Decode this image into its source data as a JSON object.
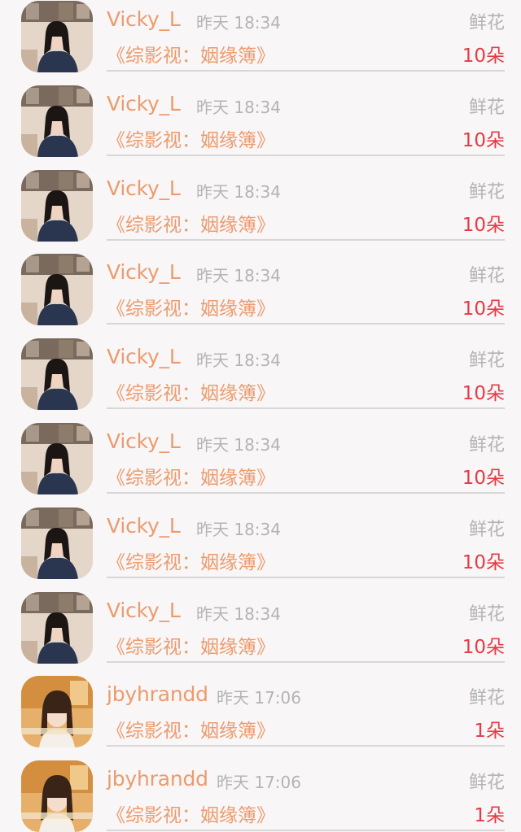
{
  "colors": {
    "username": "#ec9b6e",
    "show_title": "#ec9b6e",
    "count": "#e63a45",
    "muted": "#b4b4b4",
    "divider": "#d8d6d6",
    "background": "#f8f6f6"
  },
  "gifts": [
    {
      "avatar": "avatar-woman-indoor",
      "user": "Vicky_L",
      "time": "昨天 18:34",
      "gift_type": "鲜花",
      "show": "《综影视：姻缘簿》",
      "count": "10朵"
    },
    {
      "avatar": "avatar-woman-indoor",
      "user": "Vicky_L",
      "time": "昨天 18:34",
      "gift_type": "鲜花",
      "show": "《综影视：姻缘簿》",
      "count": "10朵"
    },
    {
      "avatar": "avatar-woman-indoor",
      "user": "Vicky_L",
      "time": "昨天 18:34",
      "gift_type": "鲜花",
      "show": "《综影视：姻缘簿》",
      "count": "10朵"
    },
    {
      "avatar": "avatar-woman-indoor",
      "user": "Vicky_L",
      "time": "昨天 18:34",
      "gift_type": "鲜花",
      "show": "《综影视：姻缘簿》",
      "count": "10朵"
    },
    {
      "avatar": "avatar-woman-indoor",
      "user": "Vicky_L",
      "time": "昨天 18:34",
      "gift_type": "鲜花",
      "show": "《综影视：姻缘簿》",
      "count": "10朵"
    },
    {
      "avatar": "avatar-woman-indoor",
      "user": "Vicky_L",
      "time": "昨天 18:34",
      "gift_type": "鲜花",
      "show": "《综影视：姻缘簿》",
      "count": "10朵"
    },
    {
      "avatar": "avatar-woman-indoor",
      "user": "Vicky_L",
      "time": "昨天 18:34",
      "gift_type": "鲜花",
      "show": "《综影视：姻缘簿》",
      "count": "10朵"
    },
    {
      "avatar": "avatar-woman-indoor",
      "user": "Vicky_L",
      "time": "昨天 18:34",
      "gift_type": "鲜花",
      "show": "《综影视：姻缘簿》",
      "count": "10朵"
    },
    {
      "avatar": "avatar-girl-portrait",
      "user": "jbyhrandd",
      "time": "昨天 17:06",
      "gift_type": "鲜花",
      "show": "《综影视：姻缘簿》",
      "count": "1朵"
    },
    {
      "avatar": "avatar-girl-portrait",
      "user": "jbyhrandd",
      "time": "昨天 17:06",
      "gift_type": "鲜花",
      "show": "《综影视：姻缘簿》",
      "count": "1朵"
    }
  ]
}
